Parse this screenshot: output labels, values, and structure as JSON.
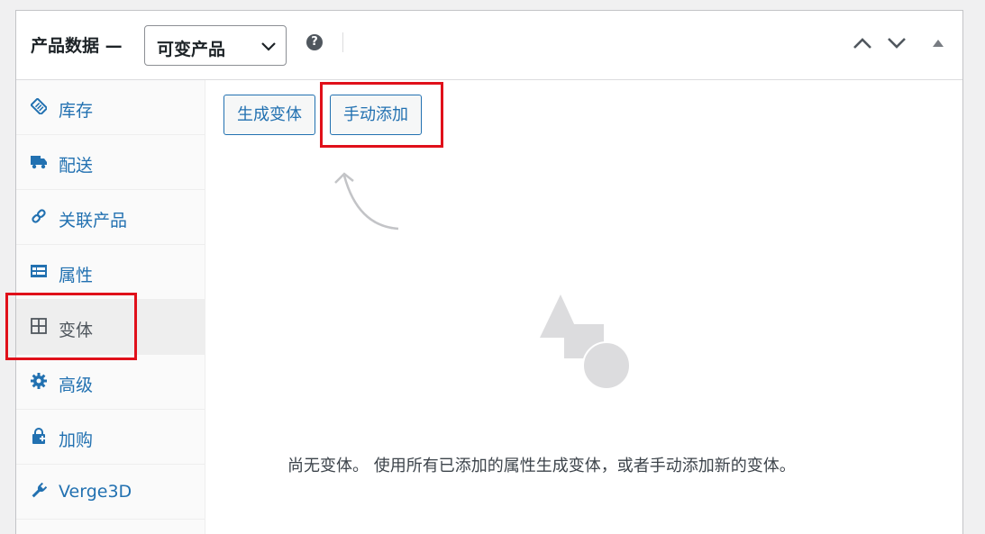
{
  "header": {
    "title": "产品数据 —",
    "product_type": "可变产品",
    "help_glyph": "?"
  },
  "tabs": [
    {
      "label": "库存",
      "icon": "tag-icon",
      "active": false
    },
    {
      "label": "配送",
      "icon": "truck-icon",
      "active": false
    },
    {
      "label": "关联产品",
      "icon": "link-icon",
      "active": false
    },
    {
      "label": "属性",
      "icon": "list-card-icon",
      "active": false
    },
    {
      "label": "变体",
      "icon": "grid-icon",
      "active": true
    },
    {
      "label": "高级",
      "icon": "gear-icon",
      "active": false
    },
    {
      "label": "加购",
      "icon": "lock-bag-icon",
      "active": false
    },
    {
      "label": "Verge3D",
      "icon": "wrench-icon",
      "active": false
    }
  ],
  "content": {
    "generate_button": "生成变体",
    "manual_add_button": "手动添加",
    "empty_message": "尚无变体。 使用所有已添加的属性生成变体，或者手动添加新的变体。"
  },
  "colors": {
    "accent": "#2271b1",
    "highlight": "#e0101a",
    "muted_icon": "#dcdcde"
  }
}
